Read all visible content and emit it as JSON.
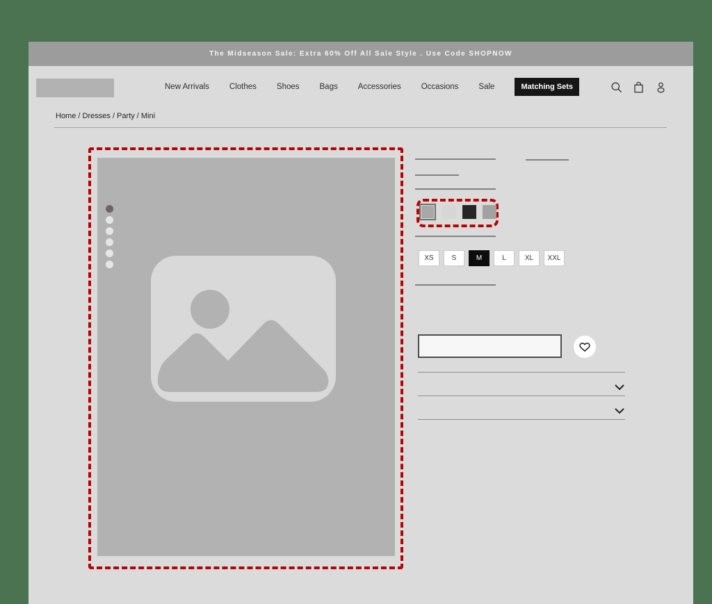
{
  "theme": {
    "outer_background": "#4B7251",
    "page_background": "#DBDBDB",
    "banner_background": "#9C9C9C",
    "annotation_red": "#B40404",
    "placeholder_gray": "#B2B2B2",
    "selected_black": "#0D0D0D"
  },
  "banner": {
    "text": "The Midseason Sale: Extra 60% Off All Sale Style . Use Code SHOPNOW"
  },
  "nav": {
    "items": [
      {
        "label": "New Arrivals",
        "active": false
      },
      {
        "label": "Clothes",
        "active": false
      },
      {
        "label": "Shoes",
        "active": false
      },
      {
        "label": "Bags",
        "active": false
      },
      {
        "label": "Accessories",
        "active": false
      },
      {
        "label": "Occasions",
        "active": false
      },
      {
        "label": "Sale",
        "active": false
      },
      {
        "label": "Matching Sets",
        "active": true
      }
    ],
    "icons": [
      "search-icon",
      "shopping-bag-icon",
      "account-icon"
    ]
  },
  "breadcrumb": {
    "text": "Home / Dresses / Party / Mini"
  },
  "gallery": {
    "thumbnail_count": 6,
    "active_thumbnail_index": 0
  },
  "product": {
    "swatches": [
      {
        "color": "#A8A8A8",
        "selected": true
      },
      {
        "color": "#D6D6D6",
        "selected": false
      },
      {
        "color": "#262626",
        "selected": false
      },
      {
        "color": "#A2A2A2",
        "selected": false
      }
    ],
    "sizes": [
      {
        "label": "XS",
        "selected": false
      },
      {
        "label": "S",
        "selected": false
      },
      {
        "label": "M",
        "selected": true
      },
      {
        "label": "L",
        "selected": false
      },
      {
        "label": "XL",
        "selected": false
      },
      {
        "label": "XXL",
        "selected": false
      }
    ],
    "accordion_sections": 2
  },
  "annotations": {
    "color": "#B40404",
    "regions": [
      "main-product-image",
      "color-swatches"
    ]
  }
}
